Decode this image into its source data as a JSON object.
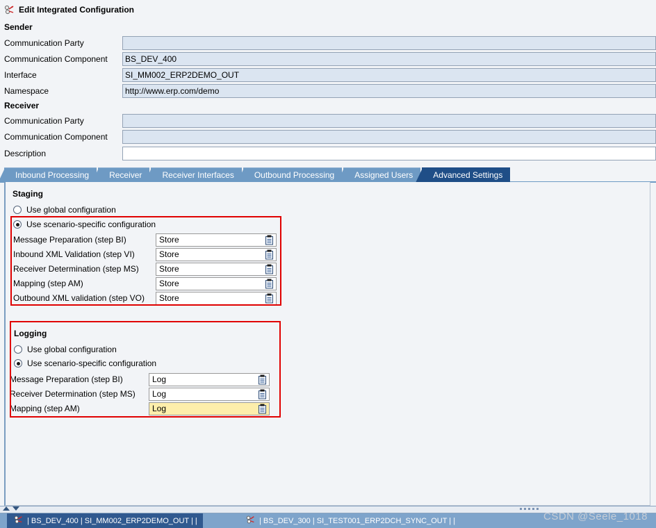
{
  "window": {
    "title": "Edit Integrated Configuration",
    "title_icon": "integrated-configuration-icon"
  },
  "sender": {
    "heading": "Sender",
    "fields": [
      {
        "label": "Communication Party",
        "value": "",
        "readonly": true
      },
      {
        "label": "Communication Component",
        "value": "BS_DEV_400",
        "readonly": true
      },
      {
        "label": "Interface",
        "value": "SI_MM002_ERP2DEMO_OUT",
        "readonly": true
      },
      {
        "label": "Namespace",
        "value": "http://www.erp.com/demo",
        "readonly": true
      }
    ]
  },
  "receiver": {
    "heading": "Receiver",
    "fields": [
      {
        "label": "Communication Party",
        "value": "",
        "readonly": true
      },
      {
        "label": "Communication Component",
        "value": "",
        "readonly": true
      },
      {
        "label": "Description",
        "value": "",
        "readonly": false
      }
    ]
  },
  "tabs": [
    {
      "label": "Inbound Processing",
      "active": false
    },
    {
      "label": "Receiver",
      "active": false
    },
    {
      "label": "Receiver Interfaces",
      "active": false
    },
    {
      "label": "Outbound Processing",
      "active": false
    },
    {
      "label": "Assigned Users",
      "active": false
    },
    {
      "label": "Advanced Settings",
      "active": true
    }
  ],
  "staging": {
    "heading": "Staging",
    "radio_global": {
      "label": "Use global configuration",
      "selected": false
    },
    "radio_scenario": {
      "label": "Use scenario-specific configuration",
      "selected": true
    },
    "options": [
      {
        "label": "Message Preparation (step BI)",
        "value": "Store",
        "focused": false
      },
      {
        "label": "Inbound XML Validation (step VI)",
        "value": "Store",
        "focused": false
      },
      {
        "label": "Receiver Determination (step MS)",
        "value": "Store",
        "focused": false
      },
      {
        "label": "Mapping (step AM)",
        "value": "Store",
        "focused": false
      },
      {
        "label": "Outbound XML validation (step VO)",
        "value": "Store",
        "focused": false
      }
    ]
  },
  "logging": {
    "heading": "Logging",
    "radio_global": {
      "label": "Use global configuration",
      "selected": false
    },
    "radio_scenario": {
      "label": "Use scenario-specific configuration",
      "selected": true
    },
    "options": [
      {
        "label": "Message Preparation (step BI)",
        "value": "Log",
        "focused": false
      },
      {
        "label": "Receiver Determination (step MS)",
        "value": "Log",
        "focused": false
      },
      {
        "label": "Mapping (step AM)",
        "value": "Log",
        "focused": true
      }
    ]
  },
  "taskbar": {
    "items": [
      {
        "label": "| BS_DEV_400 | SI_MM002_ERP2DEMO_OUT | |",
        "selected": true
      },
      {
        "label": "| BS_DEV_300 | SI_TEST001_ERP2DCH_SYNC_OUT | |",
        "selected": false
      }
    ]
  },
  "watermark": {
    "text": "CSDN @Seele_1018"
  },
  "colors": {
    "active_tab": "#1f4e87",
    "tab": "#6e9ac4",
    "field_bg": "#dbe5f1",
    "focus_field": "#fdeeab",
    "highlight_box": "#e00000",
    "taskbar": "#7ea4cb"
  }
}
